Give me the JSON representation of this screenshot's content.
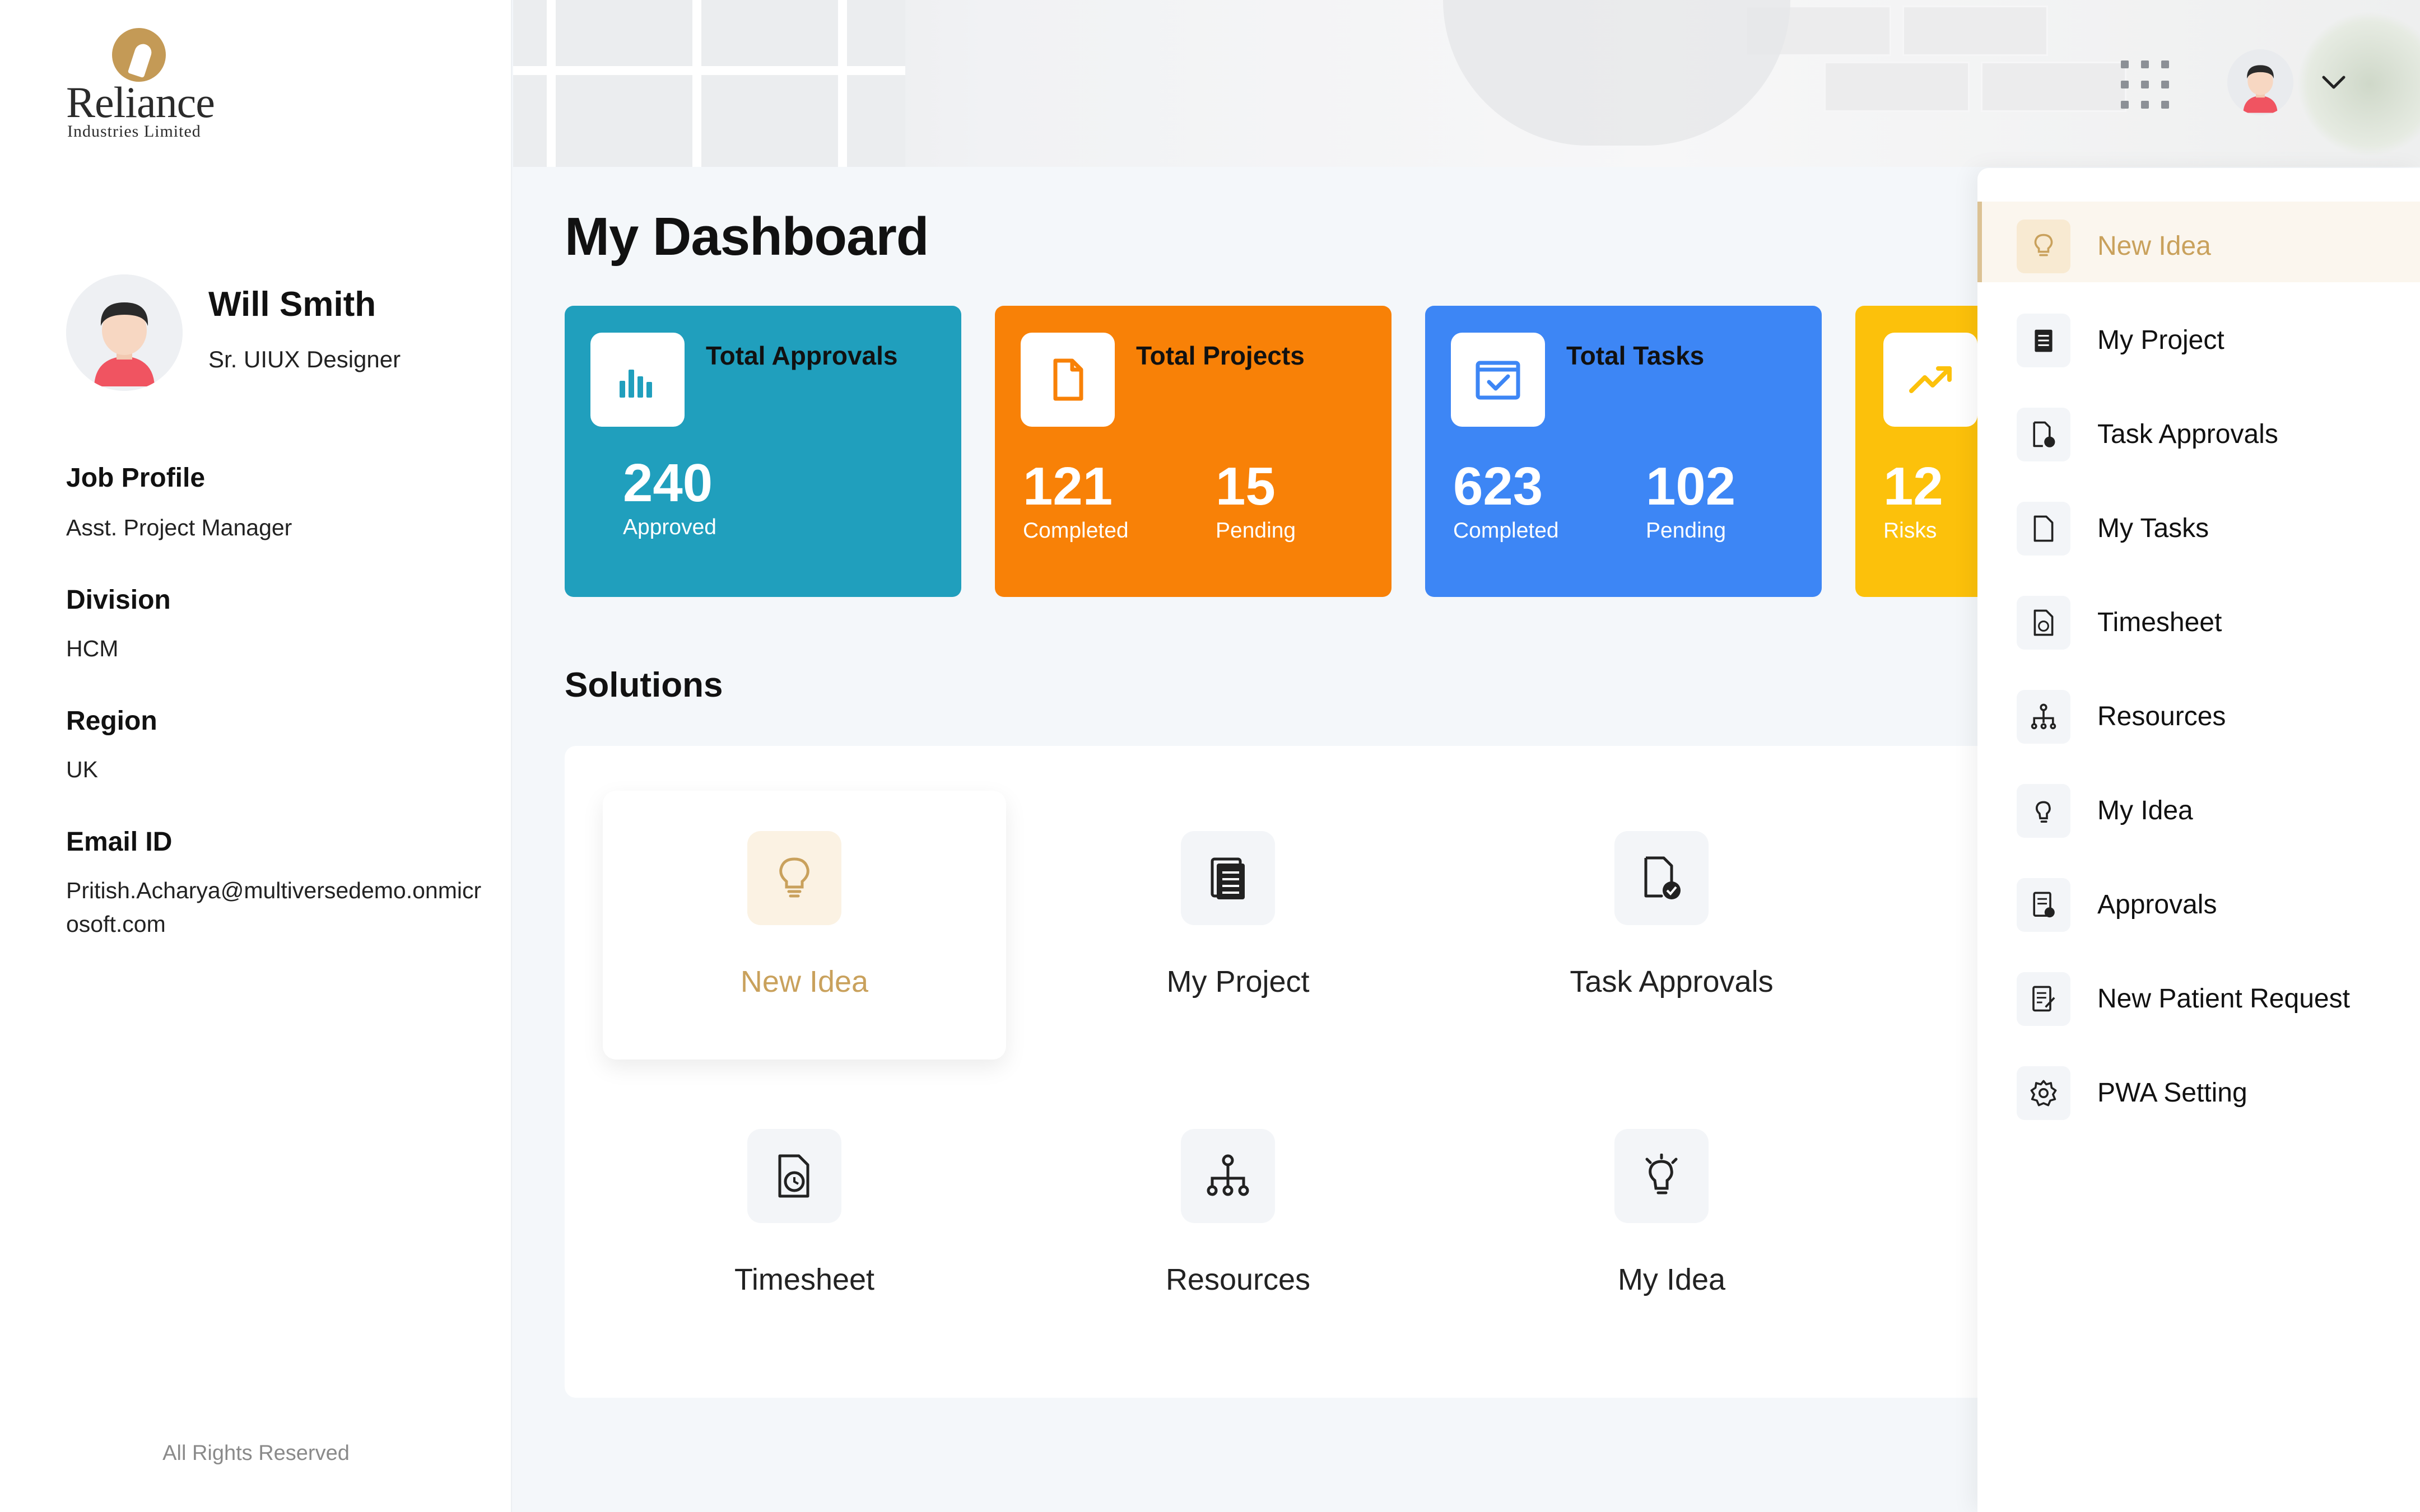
{
  "brand": {
    "name": "Reliance",
    "subtitle": "Industries Limited"
  },
  "user": {
    "name": "Will Smith",
    "role": "Sr. UIUX Designer",
    "job_profile_label": "Job Profile",
    "job_profile": "Asst. Project Manager",
    "division_label": "Division",
    "division": "HCM",
    "region_label": "Region",
    "region": "UK",
    "email_label": "Email ID",
    "email": "Pritish.Acharya@multiversedemo.onmicrosoft.com"
  },
  "footer": "All Rights Reserved",
  "page": {
    "title": "My Dashboard",
    "solutions_title": "Solutions"
  },
  "stats": [
    {
      "title": "Total Approvals",
      "value1": "240",
      "label1": "Approved",
      "color": "#209fbd",
      "icon": "bar-chart-icon"
    },
    {
      "title": "Total Projects",
      "value1": "121",
      "label1": "Completed",
      "value2": "15",
      "label2": "Pending",
      "color": "#f88107",
      "icon": "document-icon"
    },
    {
      "title": "Total Tasks",
      "value1": "623",
      "label1": "Completed",
      "value2": "102",
      "label2": "Pending",
      "color": "#3d86f5",
      "icon": "calendar-check-icon"
    },
    {
      "title": "",
      "value1": "12",
      "label1": "Risks",
      "color": "#fcc10b",
      "icon": "trending-up-icon"
    }
  ],
  "solutions": [
    {
      "label": "New Idea",
      "icon": "lightbulb-icon",
      "active": true
    },
    {
      "label": "My Project",
      "icon": "project-list-icon"
    },
    {
      "label": "Task Approvals",
      "icon": "file-check-icon"
    },
    {
      "label": "Timesheet",
      "icon": "timesheet-clock-icon"
    },
    {
      "label": "Resources",
      "icon": "org-chart-icon"
    },
    {
      "label": "My Idea",
      "icon": "idea-hand-icon"
    }
  ],
  "menu": [
    {
      "label": "New Idea",
      "icon": "lightbulb-icon",
      "active": true
    },
    {
      "label": "My Project",
      "icon": "project-list-icon"
    },
    {
      "label": "Task Approvals",
      "icon": "file-check-icon"
    },
    {
      "label": "My Tasks",
      "icon": "file-icon"
    },
    {
      "label": "Timesheet",
      "icon": "timesheet-clock-icon"
    },
    {
      "label": "Resources",
      "icon": "org-chart-icon"
    },
    {
      "label": "My Idea",
      "icon": "idea-hand-icon"
    },
    {
      "label": "Approvals",
      "icon": "approvals-icon"
    },
    {
      "label": "New Patient Request",
      "icon": "request-form-icon"
    },
    {
      "label": "PWA Setting",
      "icon": "gear-icon"
    }
  ],
  "colors": {
    "accent_gold": "#c9a15c",
    "approvals": "#209fbd",
    "projects": "#f88107",
    "tasks": "#3d86f5",
    "risks": "#fcc10b"
  }
}
